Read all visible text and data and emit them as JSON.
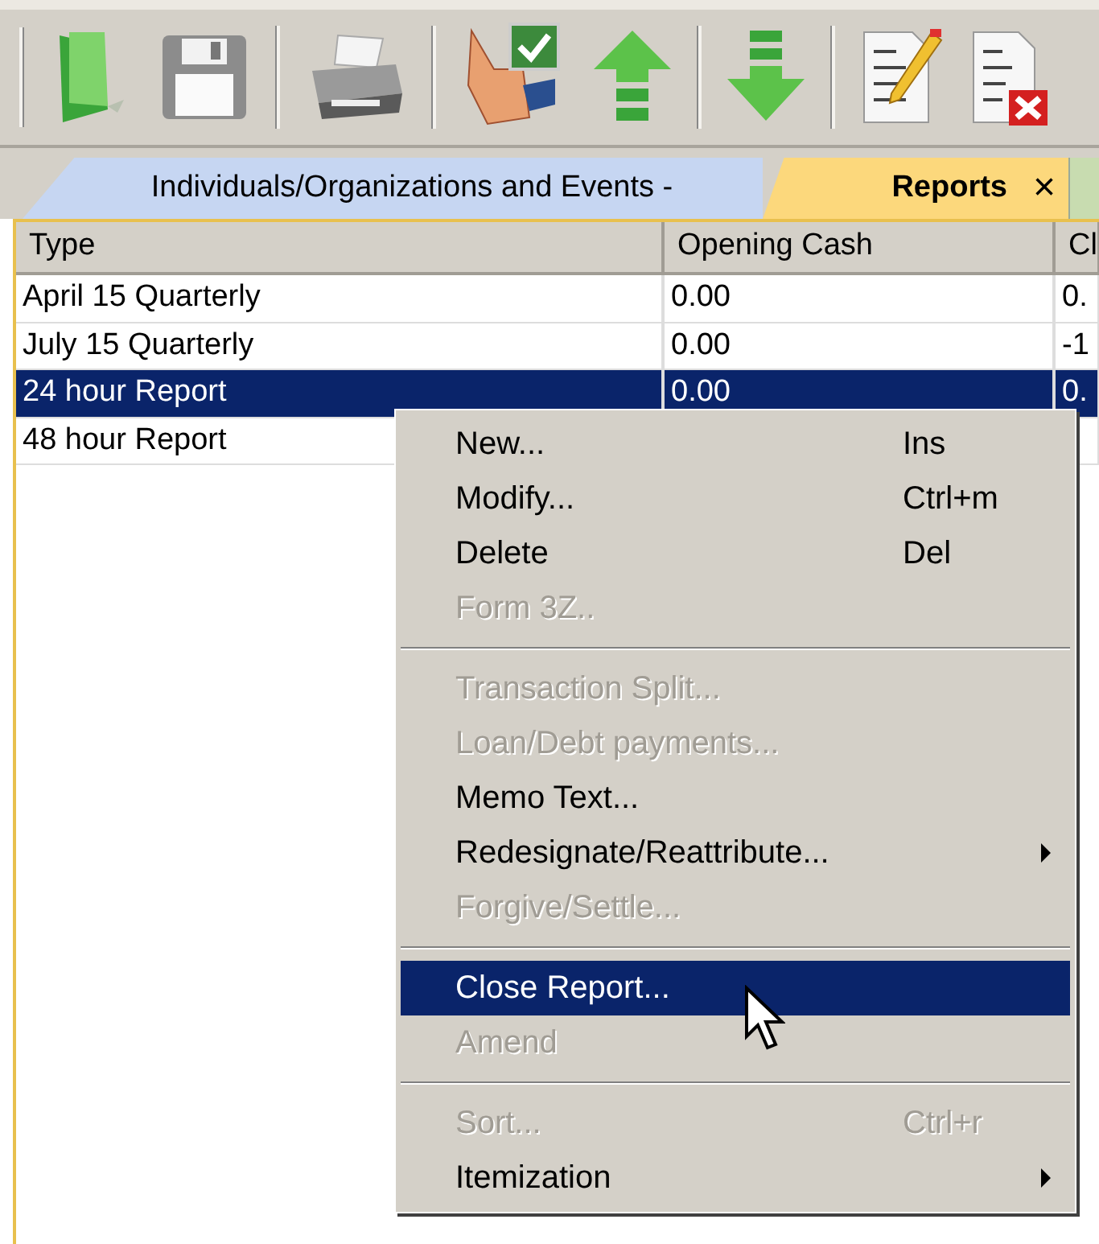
{
  "toolbar": {
    "groups": [
      {
        "buttons": [
          {
            "kind": "folder"
          },
          {
            "kind": "floppy"
          }
        ]
      },
      {
        "buttons": [
          {
            "kind": "printer"
          }
        ]
      },
      {
        "buttons": [
          {
            "kind": "approve"
          },
          {
            "kind": "up"
          }
        ]
      },
      {
        "buttons": [
          {
            "kind": "down"
          }
        ]
      },
      {
        "buttons": [
          {
            "kind": "edit-doc"
          },
          {
            "kind": "delete-doc"
          }
        ]
      }
    ]
  },
  "tabs": [
    {
      "label": "Individuals/Organizations and Events -",
      "selected": false,
      "closable": false
    },
    {
      "label": "Reports",
      "selected": true,
      "closable": true,
      "close_glyph": "×"
    }
  ],
  "table": {
    "columns": [
      "Type",
      "Opening Cash",
      "Cl"
    ],
    "rows": [
      {
        "cells": [
          "April 15 Quarterly",
          "0.00",
          "0."
        ],
        "selected": false
      },
      {
        "cells": [
          "July 15 Quarterly",
          "0.00",
          "-1"
        ],
        "selected": false
      },
      {
        "cells": [
          "24 hour Report",
          "0.00",
          "0."
        ],
        "selected": true
      },
      {
        "cells": [
          "48 hour Report"
        ],
        "selected": false
      }
    ]
  },
  "context_menu": {
    "items": [
      {
        "kind": "item",
        "label": "New...",
        "shortcut": "Ins",
        "disabled": false,
        "selected": false,
        "submenu": false
      },
      {
        "kind": "item",
        "label": "Modify...",
        "shortcut": "Ctrl+m",
        "disabled": false,
        "selected": false,
        "submenu": false
      },
      {
        "kind": "item",
        "label": "Delete",
        "shortcut": "Del",
        "disabled": false,
        "selected": false,
        "submenu": false
      },
      {
        "kind": "item",
        "label": "Form 3Z..",
        "disabled": true,
        "selected": false,
        "submenu": false
      },
      {
        "kind": "separator"
      },
      {
        "kind": "item",
        "label": "Transaction Split...",
        "disabled": true,
        "selected": false,
        "submenu": false
      },
      {
        "kind": "item",
        "label": "Loan/Debt payments...",
        "disabled": true,
        "selected": false,
        "submenu": false
      },
      {
        "kind": "item",
        "label": "Memo Text...",
        "disabled": false,
        "selected": false,
        "submenu": false
      },
      {
        "kind": "item",
        "label": "Redesignate/Reattribute...",
        "disabled": false,
        "selected": false,
        "submenu": true
      },
      {
        "kind": "item",
        "label": "Forgive/Settle...",
        "disabled": true,
        "selected": false,
        "submenu": false
      },
      {
        "kind": "separator"
      },
      {
        "kind": "item",
        "label": "Close Report...",
        "disabled": false,
        "selected": true,
        "submenu": false
      },
      {
        "kind": "item",
        "label": "Amend",
        "disabled": true,
        "selected": false,
        "submenu": false
      },
      {
        "kind": "separator"
      },
      {
        "kind": "item",
        "label": "Sort...",
        "shortcut": "Ctrl+r",
        "disabled": true,
        "selected": false,
        "submenu": false
      },
      {
        "kind": "item",
        "label": "Itemization",
        "disabled": false,
        "selected": false,
        "submenu": true
      }
    ]
  }
}
